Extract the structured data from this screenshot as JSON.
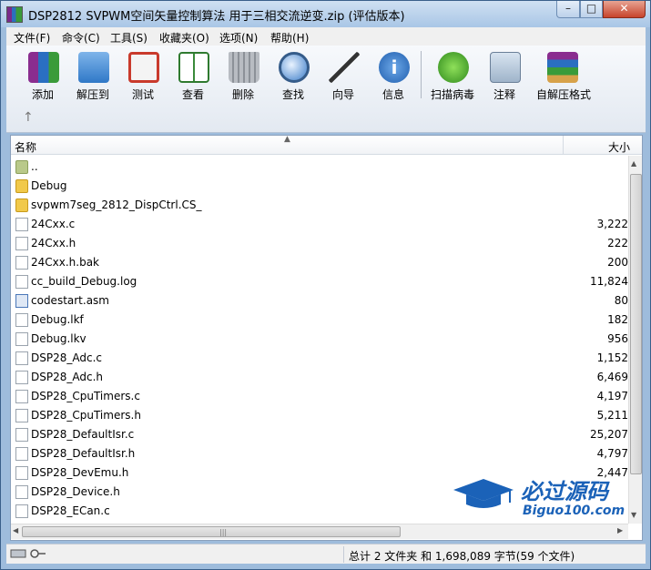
{
  "window": {
    "title": "DSP2812 SVPWM空间矢量控制算法 用于三相交流逆变.zip (评估版本)",
    "min_glyph": "–",
    "max_glyph": "□",
    "close_glyph": "✕"
  },
  "menubar": {
    "items": [
      "文件(F)",
      "命令(C)",
      "工具(S)",
      "收藏夹(O)",
      "选项(N)",
      "帮助(H)"
    ]
  },
  "toolbar": {
    "items": [
      {
        "label": "添加",
        "icon": "add-archive-icon"
      },
      {
        "label": "解压到",
        "icon": "extract-folder-icon"
      },
      {
        "label": "测试",
        "icon": "test-clipboard-icon"
      },
      {
        "label": "查看",
        "icon": "view-book-icon"
      },
      {
        "label": "删除",
        "icon": "trash-icon"
      },
      {
        "label": "查找",
        "icon": "magnifier-icon"
      },
      {
        "label": "向导",
        "icon": "wizard-wand-icon"
      },
      {
        "label": "信息",
        "icon": "info-icon"
      },
      {
        "label": "扫描病毒",
        "icon": "virus-scan-icon"
      },
      {
        "label": "注释",
        "icon": "comment-icon"
      },
      {
        "label": "自解压格式",
        "icon": "sfx-archive-icon"
      }
    ],
    "up_glyph": "↑"
  },
  "columns": {
    "name": "名称",
    "size": "大小",
    "sort_glyph": "▲"
  },
  "files": [
    {
      "name": "..",
      "size": "",
      "type": "up"
    },
    {
      "name": "Debug",
      "size": "",
      "type": "folder"
    },
    {
      "name": "svpwm7seg_2812_DispCtrl.CS_",
      "size": "",
      "type": "folder"
    },
    {
      "name": "24Cxx.c",
      "size": "3,222",
      "type": "file"
    },
    {
      "name": "24Cxx.h",
      "size": "222",
      "type": "file"
    },
    {
      "name": "24Cxx.h.bak",
      "size": "200",
      "type": "file"
    },
    {
      "name": "cc_build_Debug.log",
      "size": "11,824",
      "type": "file"
    },
    {
      "name": "codestart.asm",
      "size": "80",
      "type": "asm"
    },
    {
      "name": "Debug.lkf",
      "size": "182",
      "type": "file"
    },
    {
      "name": "Debug.lkv",
      "size": "956",
      "type": "file"
    },
    {
      "name": "DSP28_Adc.c",
      "size": "1,152",
      "type": "file"
    },
    {
      "name": "DSP28_Adc.h",
      "size": "6,469",
      "type": "file"
    },
    {
      "name": "DSP28_CpuTimers.c",
      "size": "4,197",
      "type": "file"
    },
    {
      "name": "DSP28_CpuTimers.h",
      "size": "5,211",
      "type": "file"
    },
    {
      "name": "DSP28_DefaultIsr.c",
      "size": "25,207",
      "type": "file"
    },
    {
      "name": "DSP28_DefaultIsr.h",
      "size": "4,797",
      "type": "file"
    },
    {
      "name": "DSP28_DevEmu.h",
      "size": "2,447",
      "type": "file"
    },
    {
      "name": "DSP28_Device.h",
      "size": "",
      "type": "file"
    },
    {
      "name": "DSP28_ECan.c",
      "size": "",
      "type": "file"
    }
  ],
  "status": {
    "summary": "总计 2 文件夹 和 1,698,089 字节(59 个文件)"
  },
  "watermark": {
    "line1": "必过源码",
    "line2": "Biguo100.com"
  },
  "colors": {
    "title_bg": "#a9c6e6",
    "folder": "#f1c94a",
    "watermark": "#1b62b8",
    "close_btn": "#c7442c"
  }
}
